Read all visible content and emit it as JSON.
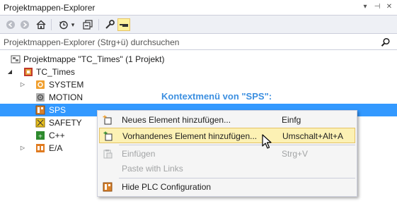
{
  "window": {
    "title": "Projektmappen-Explorer",
    "dropdown_glyph": "▾",
    "pin_glyph": "⊣",
    "close_glyph": "✕"
  },
  "toolbar": {
    "icons": [
      "back-icon",
      "forward-icon",
      "home-icon",
      "history-icon",
      "collapse-all-icon",
      "properties-icon",
      "show-all-files-icon"
    ],
    "history_dropdown_glyph": "▾"
  },
  "search": {
    "placeholder": "Projektmappen-Explorer (Strg+ü) durchsuchen"
  },
  "tree": {
    "solution": {
      "label": "Projektmappe \"TC_Times\" (1 Projekt)"
    },
    "project": {
      "label": "TC_Times",
      "expander": "◢"
    },
    "items": [
      {
        "label": "SYSTEM",
        "expander": "▷",
        "icon": "system-icon",
        "color": "#f0a030"
      },
      {
        "label": "MOTION",
        "expander": "",
        "icon": "motion-icon",
        "color": "#a0a0a0"
      },
      {
        "label": "SPS",
        "expander": "",
        "icon": "plc-icon",
        "color": "#d9822b"
      },
      {
        "label": "SAFETY",
        "expander": "",
        "icon": "safety-icon",
        "color": "#e8c020"
      },
      {
        "label": "C++",
        "expander": "",
        "icon": "cpp-icon",
        "color": "#2d8a2d"
      },
      {
        "label": "E/A",
        "expander": "▷",
        "icon": "io-icon",
        "color": "#e07b20"
      }
    ]
  },
  "annotation": "Kontextmenü von \"SPS\":",
  "context_menu": {
    "items": [
      {
        "label": "Neues Element hinzufügen...",
        "shortcut": "Einfg",
        "icon": "new-item-icon",
        "disabled": false,
        "highlighted": false
      },
      {
        "label": "Vorhandenes Element hinzufügen...",
        "shortcut": "Umschalt+Alt+A",
        "icon": "add-existing-item-icon",
        "disabled": false,
        "highlighted": true
      },
      {
        "label": "Einfügen",
        "shortcut": "Strg+V",
        "icon": "paste-icon",
        "disabled": true,
        "highlighted": false
      },
      {
        "label": "Paste with Links",
        "shortcut": "",
        "icon": "",
        "disabled": true,
        "highlighted": false
      },
      {
        "label": "Hide PLC Configuration",
        "shortcut": "",
        "icon": "hide-plc-config-icon",
        "disabled": false,
        "highlighted": false
      }
    ]
  },
  "colors": {
    "selection": "#3399ff",
    "annotation": "#3c8fe0",
    "highlight": "#fcf1b4",
    "toolbar_bg": "#eef0f5"
  }
}
